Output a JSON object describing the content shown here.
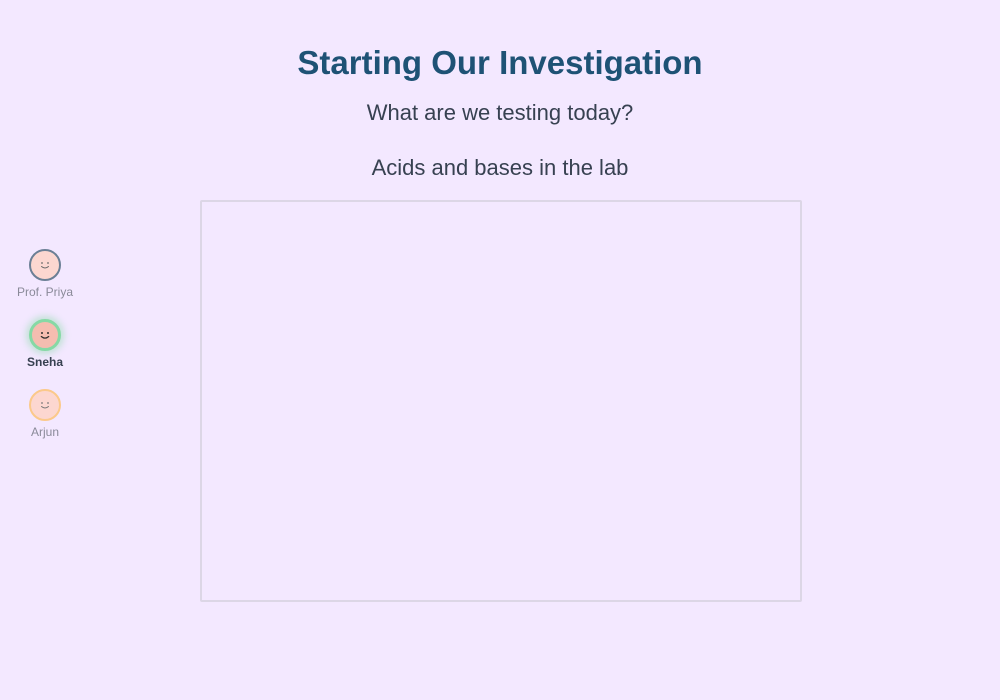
{
  "slide": {
    "title": "Starting Our Investigation",
    "subtitle": "What are we testing today?",
    "topic": "Acids and bases in the lab"
  },
  "participants": [
    {
      "name": "Prof. Priya",
      "icon": "smiley-face-icon",
      "ring_color": "#6b7f95",
      "fill_color": "#fcd7d0",
      "speaking": false
    },
    {
      "name": "Sneha",
      "icon": "smiley-face-icon",
      "ring_color": "#86d9a5",
      "fill_color": "#f5bdb0",
      "speaking": true
    },
    {
      "name": "Arjun",
      "icon": "smiley-face-icon",
      "ring_color": "#fbc98a",
      "fill_color": "#fcd7d0",
      "speaking": false
    }
  ]
}
